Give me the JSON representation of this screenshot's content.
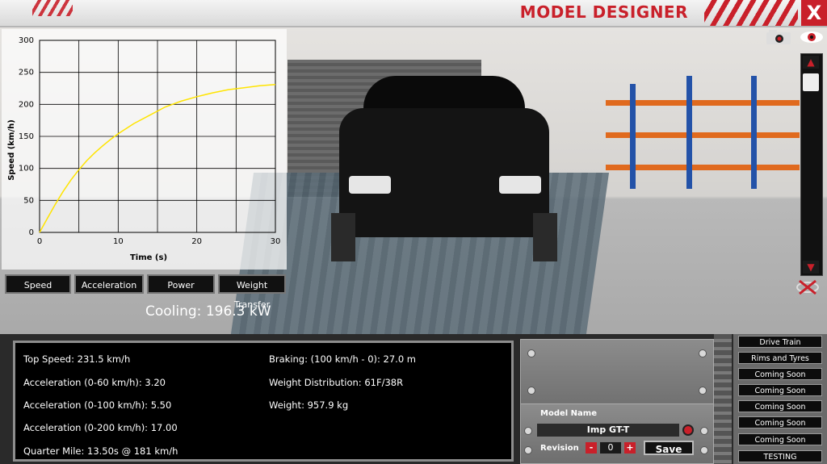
{
  "header": {
    "title": "MODEL DESIGNER",
    "close_label": "X"
  },
  "chart_data": {
    "type": "line",
    "xlabel": "Time (s)",
    "ylabel": "Speed (km/h)",
    "xlim": [
      0,
      30
    ],
    "ylim": [
      0,
      300
    ],
    "x_ticks": [
      "0",
      "10",
      "20",
      "30"
    ],
    "y_ticks": [
      "0",
      "50",
      "100",
      "150",
      "200",
      "250",
      "300"
    ],
    "grid": true,
    "series": [
      {
        "color": "#ffe400",
        "x": [
          0,
          1,
          2,
          3,
          4,
          5,
          6,
          7,
          8,
          9,
          10,
          12,
          14,
          16,
          18,
          20,
          22,
          24,
          26,
          28,
          30
        ],
        "y": [
          0,
          22,
          44,
          64,
          82,
          98,
          112,
          124,
          135,
          145,
          154,
          170,
          183,
          196,
          205,
          212,
          218,
          223,
          226,
          229,
          231
        ]
      }
    ]
  },
  "chart_tabs": [
    "Speed",
    "Acceleration",
    "Power",
    "Weight Transfer"
  ],
  "cooling": "Cooling: 196.3 kW",
  "stats": {
    "left": [
      "Top Speed: 231.5 km/h",
      "Acceleration (0-60 km/h): 3.20",
      "Acceleration (0-100 km/h): 5.50",
      "Acceleration (0-200 km/h): 17.00",
      "Quarter Mile: 13.50s @ 181 km/h"
    ],
    "right": [
      "Braking: (100 km/h - 0): 27.0 m",
      "Weight Distribution: 61F/38R",
      "Weight: 957.9 kg"
    ]
  },
  "model": {
    "name_label": "Model Name",
    "name_value": "Imp GT-T",
    "revision_label": "Revision",
    "revision_value": "0",
    "minus": "-",
    "plus": "+",
    "save_label": "Save"
  },
  "side_menu": [
    "Drive Train",
    "Rims and Tyres",
    "Coming Soon",
    "Coming Soon",
    "Coming Soon",
    "Coming Soon",
    "Coming Soon",
    "TESTING"
  ],
  "colors": {
    "accent": "#c9202a",
    "chart_line": "#ffe400"
  }
}
